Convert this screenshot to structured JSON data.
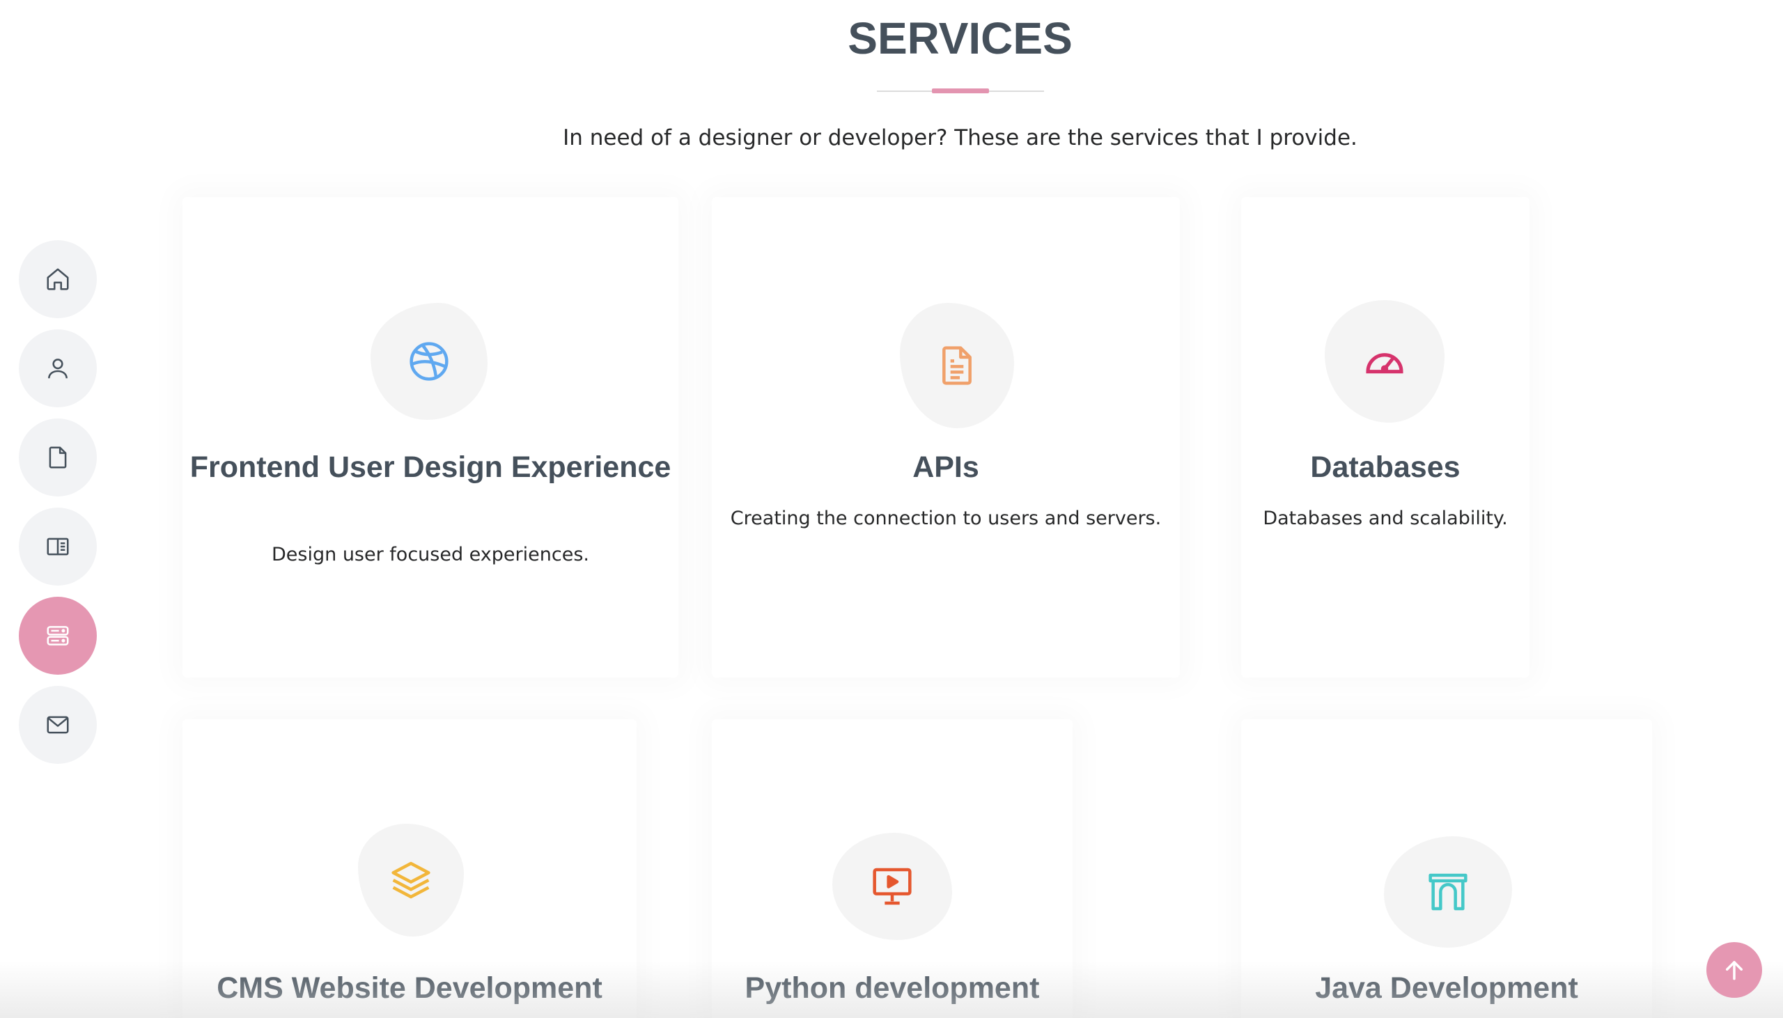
{
  "section": {
    "title": "SERVICES",
    "subtitle": "In need of a designer or developer? These are the services that I provide."
  },
  "nav": {
    "items": [
      {
        "icon": "home-icon"
      },
      {
        "icon": "user-icon"
      },
      {
        "icon": "file-icon"
      },
      {
        "icon": "book-open-icon"
      },
      {
        "icon": "server-icon",
        "active": true
      },
      {
        "icon": "envelope-icon"
      }
    ],
    "active_color": "#e597b2"
  },
  "services": [
    {
      "title": "Frontend User Design Experience",
      "desc": "Design user focused experiences.",
      "icon": "dribbble-icon",
      "color": "#5fa8f0"
    },
    {
      "title": "APIs",
      "desc": "Creating the connection to users and servers.",
      "icon": "file-text-icon",
      "color": "#f0a06a"
    },
    {
      "title": "Databases",
      "desc": "Databases and scalability.",
      "icon": "speedometer-icon",
      "color": "#d6336c"
    },
    {
      "title": "CMS Website Development",
      "desc": "",
      "icon": "layers-icon",
      "color": "#f2b63a"
    },
    {
      "title": "Python development",
      "desc": "",
      "icon": "presentation-icon",
      "color": "#e5572e"
    },
    {
      "title": "Java Development",
      "desc": "",
      "icon": "archway-icon",
      "color": "#44c8c8"
    }
  ],
  "accent_color": "#e597b2"
}
